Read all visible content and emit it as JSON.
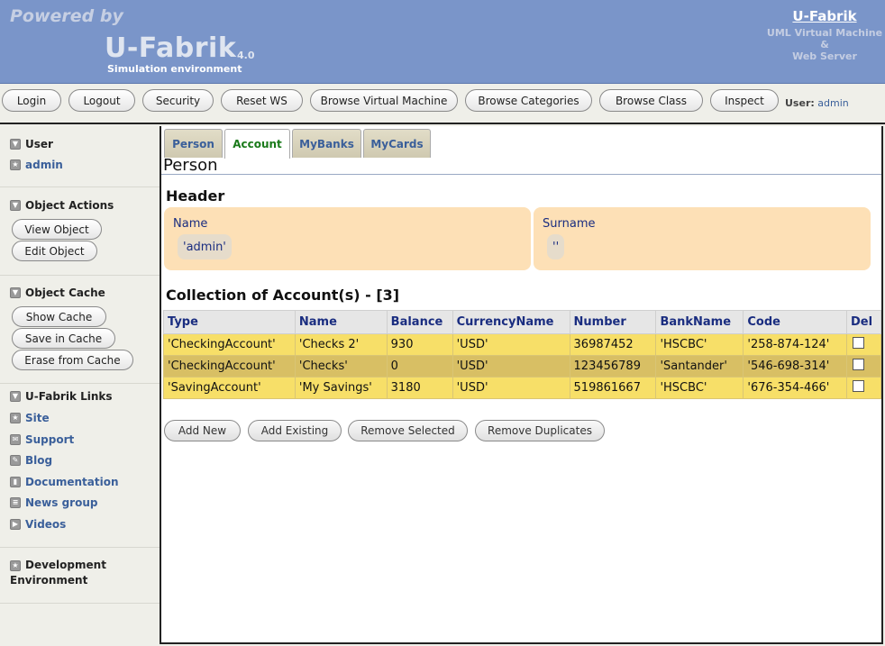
{
  "banner": {
    "powered": "Powered by",
    "brand": "U-Fabrik",
    "version": "4.0",
    "subtitle": "Simulation environment",
    "right_title": "U-Fabrik",
    "right_sub1": "UML Virtual Machine",
    "right_sub2": "&",
    "right_sub3": "Web Server"
  },
  "toolbar": {
    "buttons": [
      "Login",
      "Logout",
      "Security",
      "Reset WS",
      "Browse Virtual Machine",
      "Browse Categories",
      "Browse Class",
      "Inspect"
    ],
    "user_label": "User:",
    "user_value": "admin"
  },
  "sidebar": {
    "user_head": "User",
    "user_link": "admin",
    "actions_head": "Object Actions",
    "view_object": "View Object",
    "edit_object": "Edit Object",
    "cache_head": "Object Cache",
    "show_cache": "Show Cache",
    "save_cache": "Save in Cache",
    "erase_cache": "Erase from Cache",
    "links_head": "U-Fabrik Links",
    "links": [
      "Site",
      "Support",
      "Blog",
      "Documentation",
      "News group",
      "Videos"
    ],
    "dev_head_1": "Development",
    "dev_head_2": "Environment"
  },
  "main": {
    "tabs": [
      "Person",
      "Account",
      "MyBanks",
      "MyCards"
    ],
    "active_tab": "Account",
    "page_title": "Person",
    "header_title": "Header",
    "name_label": "Name",
    "name_value": "'admin'",
    "surname_label": "Surname",
    "surname_value": "''",
    "collection_title": "Collection of Account(s) - [3]",
    "columns": [
      "Type",
      "Name",
      "Balance",
      "CurrencyName",
      "Number",
      "BankName",
      "Code",
      "Del"
    ],
    "rows": [
      [
        "'CheckingAccount'",
        "'Checks 2'",
        "930",
        "'USD'",
        "36987452",
        "'HSCBC'",
        "'258-874-124'"
      ],
      [
        "'CheckingAccount'",
        "'Checks'",
        "0",
        "'USD'",
        "123456789",
        "'Santander'",
        "'546-698-314'"
      ],
      [
        "'SavingAccount'",
        "'My Savings'",
        "3180",
        "'USD'",
        "519861667",
        "'HSCBC'",
        "'676-354-466'"
      ]
    ],
    "actions": [
      "Add New",
      "Add Existing",
      "Remove Selected",
      "Remove Duplicates"
    ]
  }
}
